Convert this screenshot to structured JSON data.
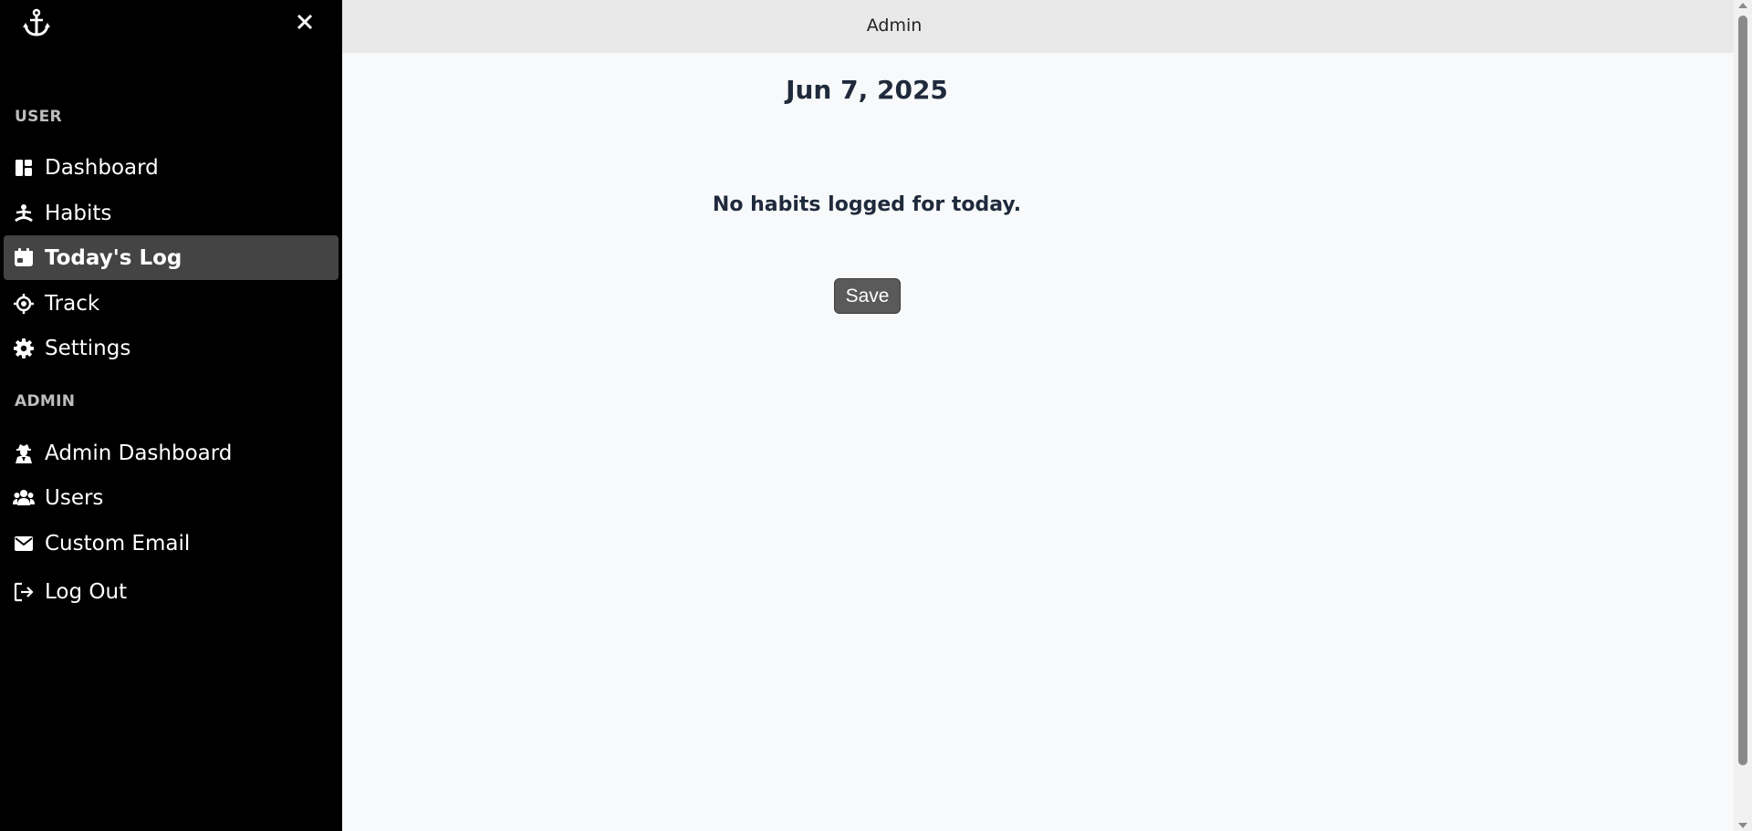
{
  "header": {
    "title": "Admin"
  },
  "sidebar": {
    "logo_icon": "anchor-icon",
    "close_icon": "close-icon",
    "sections": [
      {
        "label": "USER",
        "items": [
          {
            "label": "Dashboard",
            "icon": "dashboard-icon"
          },
          {
            "label": "Habits",
            "icon": "meditation-icon"
          },
          {
            "label": "Today's Log",
            "icon": "calendar-icon",
            "active": true
          },
          {
            "label": "Track",
            "icon": "crosshair-icon"
          },
          {
            "label": "Settings",
            "icon": "gear-icon"
          }
        ]
      },
      {
        "label": "ADMIN",
        "items": [
          {
            "label": "Admin Dashboard",
            "icon": "user-secret-icon"
          },
          {
            "label": "Users",
            "icon": "users-icon"
          },
          {
            "label": "Custom Email",
            "icon": "envelope-icon"
          },
          {
            "label": "Log Out",
            "icon": "logout-icon"
          }
        ]
      }
    ]
  },
  "main": {
    "date": "Jun 7, 2025",
    "empty_message": "No habits logged for today.",
    "save_label": "Save"
  },
  "colors": {
    "sidebar_bg": "#000000",
    "active_item_bg": "#444444",
    "topbar_bg": "#e9e9e9",
    "content_bg": "#f8f9fa",
    "heading_text": "#1f2a3c",
    "button_bg": "#5a5a5a"
  }
}
